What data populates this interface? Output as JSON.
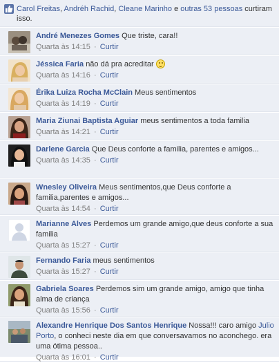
{
  "likes": {
    "names": [
      "Carol Freitas",
      "Andréh Rachid",
      "Cleane Marinho"
    ],
    "and_text": "e",
    "others_link": "outras 53 pessoas",
    "suffix": "curtiram isso."
  },
  "comments": [
    {
      "name": "André Menezes Gomes",
      "text": "Que triste, cara!!",
      "time": "Quarta às 14:15",
      "action": "Curtir"
    },
    {
      "name": "Jéssica Faria",
      "text": "não dá pra acreditar",
      "time": "Quarta às 14:16",
      "action": "Curtir",
      "emoji": "smiley-icon"
    },
    {
      "name": "Érika Luiza Rocha McClain",
      "text": "Meus sentimentos",
      "time": "Quarta às 14:19",
      "action": "Curtir"
    },
    {
      "name": "Maria Ziunai Baptista Aguiar",
      "text": "meus sentimentos a toda familia",
      "time": "Quarta às 14:21",
      "action": "Curtir"
    },
    {
      "name": "Darlene Garcia",
      "text": "Que Deus conforte a familia, parentes e amigos...",
      "time": "Quarta às 14:35",
      "action": "Curtir"
    },
    {
      "name": "Wnesley Oliveira",
      "text": "Meus sentimentos,que Deus conforte a familia,parentes e amigos...",
      "time": "Quarta às 14:54",
      "action": "Curtir"
    },
    {
      "name": "Marianne Alves",
      "text": "Perdemos um grande amigo,que deus conforte a sua familia",
      "time": "Quarta às 15:27",
      "action": "Curtir"
    },
    {
      "name": "Fernando Faria",
      "text": "meus sentimentos",
      "time": "Quarta às 15:27",
      "action": "Curtir"
    },
    {
      "name": "Gabriela Soares",
      "text": "Perdemos sim um grande amigo, amigo que tinha alma de criança",
      "time": "Quarta às 15:56",
      "action": "Curtir"
    },
    {
      "name": "Alexandre Henrique Dos Santos Henrique",
      "text_before": "Nossa!!! caro amigo",
      "mention": "Julio Porto",
      "text_after": ", o conheci neste dia em que conversavamos no aconchego. era uma ótima pessoa..",
      "time": "Quarta às 16:01",
      "action": "Curtir"
    }
  ],
  "separator": "·",
  "colors": {
    "link": "#3b5998",
    "meta": "#808080",
    "background": "#eceff5"
  }
}
